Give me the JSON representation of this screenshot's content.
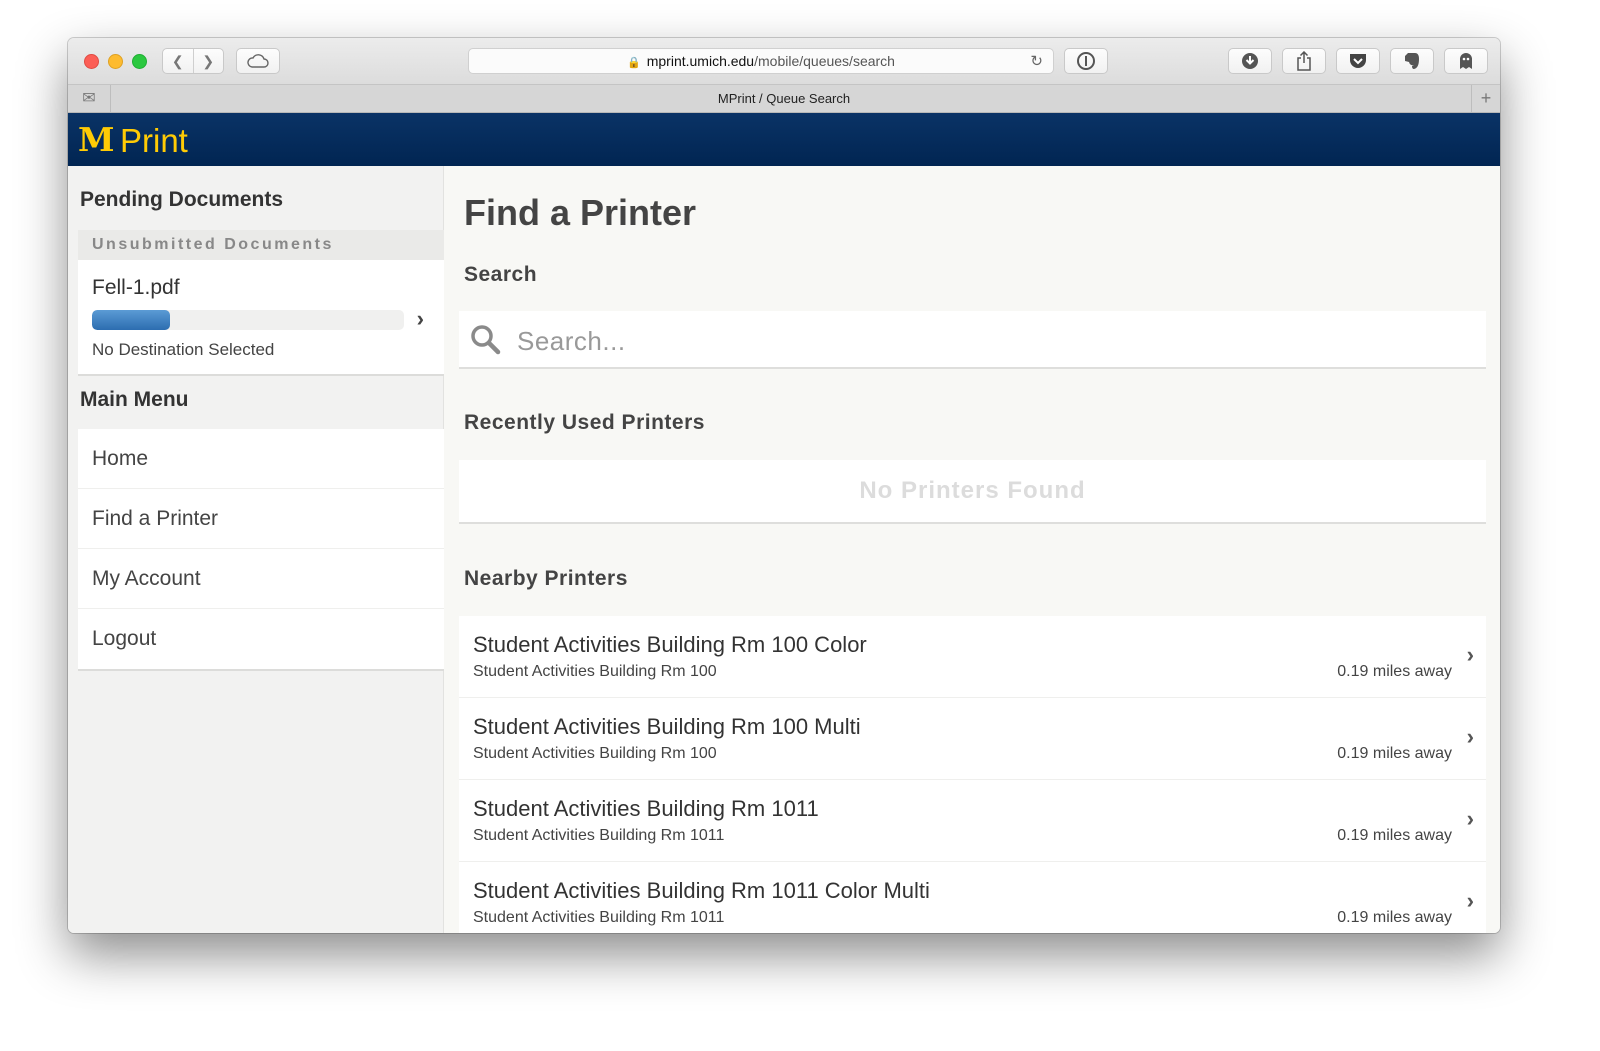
{
  "browser": {
    "url_host": "mprint.umich.edu",
    "url_path": "/mobile/queues/search",
    "tab_title": "MPrint / Queue Search"
  },
  "app": {
    "logo_m": "M",
    "logo_text": "Print",
    "brand_color": "#ffcb05",
    "header_color": "#012552"
  },
  "sidebar": {
    "pending_heading": "Pending Documents",
    "unsubmitted_label": "Unsubmitted Documents",
    "document": {
      "name": "Fell-1.pdf",
      "progress": 0.25,
      "destination": "No Destination Selected"
    },
    "main_menu_heading": "Main Menu",
    "menu_items": [
      {
        "label": "Home"
      },
      {
        "label": "Find a Printer"
      },
      {
        "label": "My Account"
      },
      {
        "label": "Logout"
      }
    ]
  },
  "main": {
    "title": "Find a Printer",
    "search_heading": "Search",
    "search_placeholder": "Search...",
    "recent_heading": "Recently Used Printers",
    "no_printers_text": "No Printers Found",
    "nearby_heading": "Nearby Printers",
    "nearby_printers": [
      {
        "name": "Student Activities Building Rm 100 Color",
        "location": "Student Activities Building Rm 100",
        "distance": "0.19 miles away"
      },
      {
        "name": "Student Activities Building Rm 100 Multi",
        "location": "Student Activities Building Rm 100",
        "distance": "0.19 miles away"
      },
      {
        "name": "Student Activities Building Rm 1011",
        "location": "Student Activities Building Rm 1011",
        "distance": "0.19 miles away"
      },
      {
        "name": "Student Activities Building Rm 1011 Color Multi",
        "location": "Student Activities Building Rm 1011",
        "distance": "0.19 miles away"
      }
    ]
  }
}
